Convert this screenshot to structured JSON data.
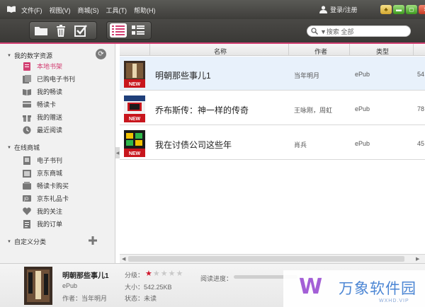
{
  "menu": [
    "文件(F)",
    "视图(V)",
    "商城(S)",
    "工具(T)",
    "帮助(H)"
  ],
  "login_label": "登录/注册",
  "window_buttons": {
    "skin": "♣",
    "min": "▬",
    "max": "◻",
    "close": "✕"
  },
  "search": {
    "placeholder": "▼搜索 全部"
  },
  "sidebar": {
    "sections": [
      {
        "label": "我的数字资源"
      },
      {
        "label": "在线商城"
      },
      {
        "label": "自定义分类"
      }
    ],
    "my_items": [
      {
        "label": "本地书架",
        "icon": "book-icon",
        "selected": true
      },
      {
        "label": "已购电子书刊",
        "icon": "purchased-icon"
      },
      {
        "label": "我的畅读",
        "icon": "open-book-icon"
      },
      {
        "label": "畅读卡",
        "icon": "card-icon"
      },
      {
        "label": "我的赠送",
        "icon": "gift-icon"
      },
      {
        "label": "最近阅读",
        "icon": "clock-icon"
      }
    ],
    "store_items": [
      {
        "label": "电子书刊",
        "icon": "ebook-icon"
      },
      {
        "label": "京东商城",
        "icon": "store-icon"
      },
      {
        "label": "畅读卡购买",
        "icon": "card-buy-icon"
      },
      {
        "label": "京东礼品卡",
        "icon": "giftcard-icon"
      },
      {
        "label": "我的关注",
        "icon": "heart-icon"
      },
      {
        "label": "我的订单",
        "icon": "order-icon"
      }
    ]
  },
  "table": {
    "columns": [
      "名称",
      "作者",
      "类型"
    ],
    "rows": [
      {
        "name": "明朝那些事儿1",
        "author": "当年明月",
        "type": "ePub",
        "extra": "54",
        "cover_badge": "NEW"
      },
      {
        "name": "乔布斯传：神一样的传奇",
        "author": "王咏刚，周虹",
        "type": "ePub",
        "extra": "78",
        "cover_badge": "NEW"
      },
      {
        "name": "我在讨债公司这些年",
        "author": "肖兵",
        "type": "ePub",
        "extra": "45",
        "cover_badge": "NEW"
      }
    ]
  },
  "detail": {
    "title": "明朝那些事儿1",
    "format": "ePub",
    "author_line": "作者：当年明月",
    "rating_label": "分级：",
    "rating": 1,
    "size_line": "大小：542.25KB",
    "status_line": "状态：未读",
    "progress_label": "阅读进度："
  },
  "watermark": {
    "logo": "W",
    "text": "万象软件园",
    "sub": "WXHD.VIP"
  },
  "colors": {
    "accent": "#d23f72",
    "titlebar": "#4a4946",
    "selected_row": "#e8f1fb"
  }
}
